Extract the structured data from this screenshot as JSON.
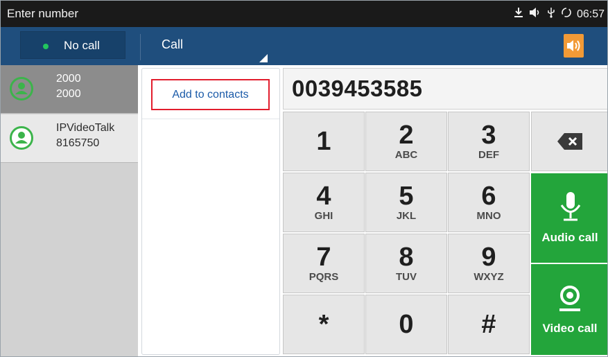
{
  "status_bar": {
    "title": "Enter number",
    "time": "06:57",
    "icons": [
      "download-icon",
      "volume-icon",
      "usb-icon",
      "sync-icon"
    ]
  },
  "header": {
    "call_status": "No call",
    "call_tab_label": "Call",
    "status_dot_color": "#22c55e",
    "speaker_color": "#f29a36"
  },
  "contacts": [
    {
      "name": "2000",
      "number": "2000",
      "selected": true
    },
    {
      "name": "IPVideoTalk",
      "number": "8165750",
      "selected": false
    }
  ],
  "mid_panel": {
    "add_to_contacts_label": "Add to contacts"
  },
  "dialer": {
    "number": "0039453585",
    "keys": [
      {
        "digit": "1",
        "letters": ""
      },
      {
        "digit": "2",
        "letters": "ABC"
      },
      {
        "digit": "3",
        "letters": "DEF"
      },
      {
        "digit": "4",
        "letters": "GHI"
      },
      {
        "digit": "5",
        "letters": "JKL"
      },
      {
        "digit": "6",
        "letters": "MNO"
      },
      {
        "digit": "7",
        "letters": "PQRS"
      },
      {
        "digit": "8",
        "letters": "TUV"
      },
      {
        "digit": "9",
        "letters": "WXYZ"
      },
      {
        "digit": "*",
        "letters": ""
      },
      {
        "digit": "0",
        "letters": ""
      },
      {
        "digit": "#",
        "letters": ""
      }
    ],
    "audio_call_label": "Audio call",
    "video_call_label": "Video call",
    "accent_green": "#23a53b"
  }
}
